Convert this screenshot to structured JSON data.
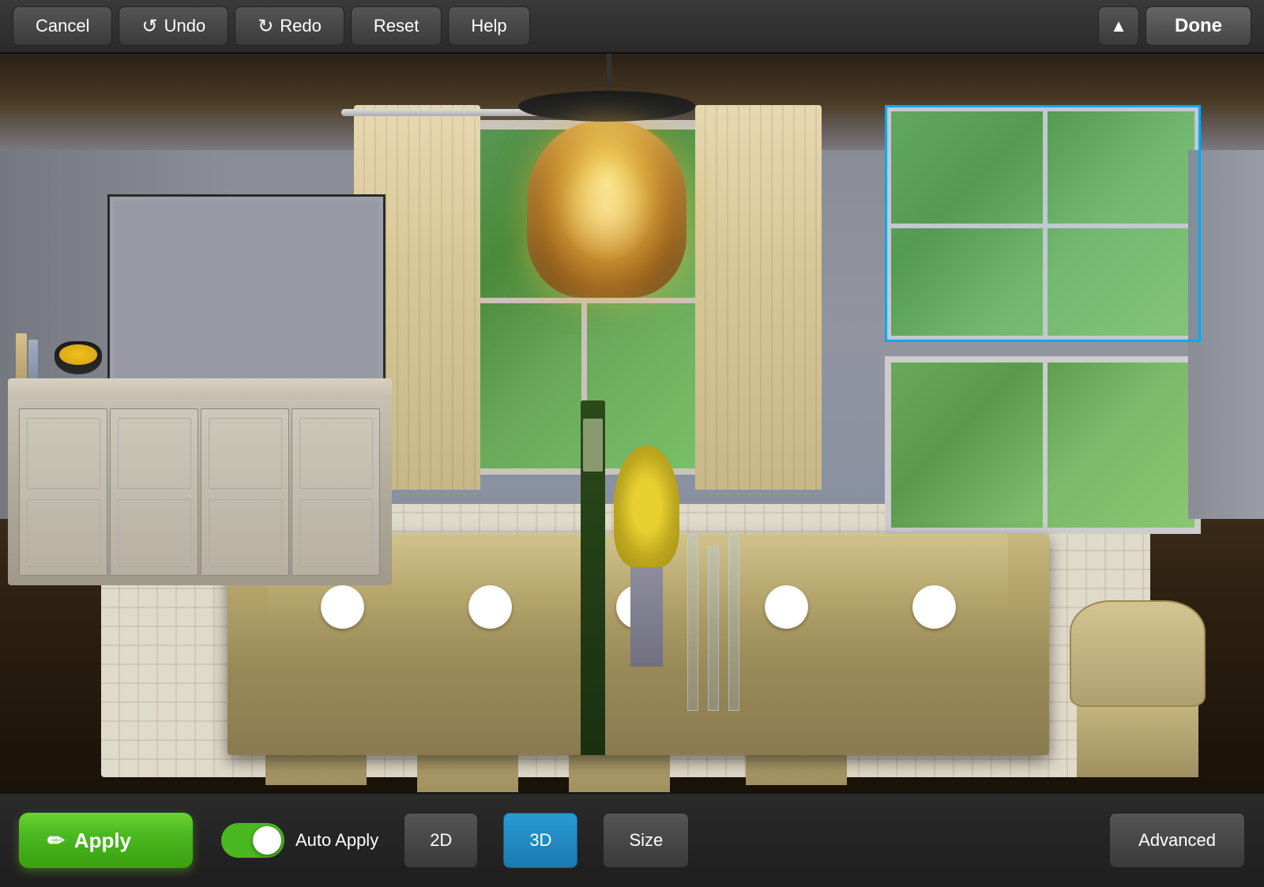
{
  "toolbar": {
    "cancel_label": "Cancel",
    "undo_label": "Undo",
    "redo_label": "Redo",
    "reset_label": "Reset",
    "help_label": "Help",
    "done_label": "Done",
    "chevron_label": "▲"
  },
  "bottom_bar": {
    "apply_label": "Apply",
    "apply_icon": "✏",
    "auto_apply_label": "Auto Apply",
    "toggle_state": "on",
    "mode_2d_label": "2D",
    "mode_3d_label": "3D",
    "size_label": "Size",
    "advanced_label": "Advanced",
    "active_mode": "3D"
  },
  "scene": {
    "painting_frame_visible": true,
    "window_selection_visible": true
  },
  "colors": {
    "active_mode_bg": "#1a7ab0",
    "apply_btn_bg": "#4ab820",
    "toolbar_bg": "#2e2e2e",
    "toggle_on": "#4ab820"
  }
}
